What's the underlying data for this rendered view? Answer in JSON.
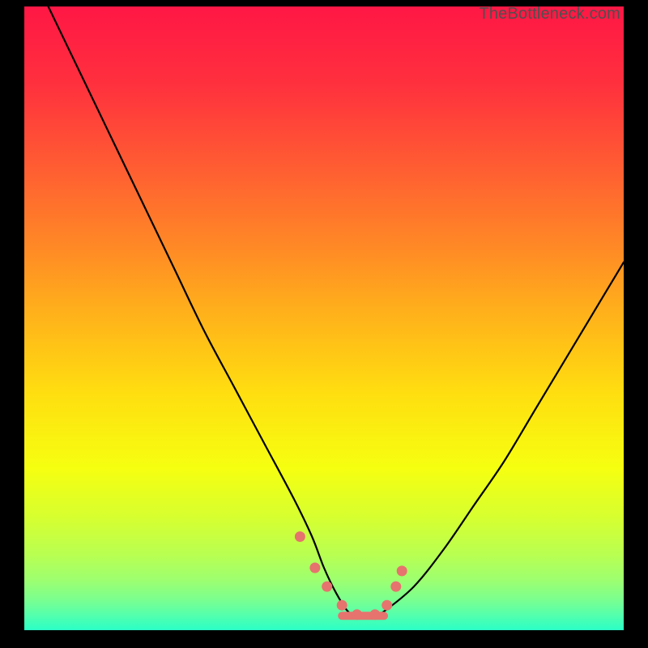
{
  "watermark": "TheBottleneck.com",
  "chart_data": {
    "type": "line",
    "title": "",
    "xlabel": "",
    "ylabel": "",
    "xlim": [
      0,
      100
    ],
    "ylim": [
      0,
      100
    ],
    "grid": false,
    "legend": false,
    "annotations": [],
    "series": [
      {
        "name": "main-curve",
        "x": [
          4,
          10,
          15,
          20,
          25,
          30,
          35,
          40,
          45,
          48,
          50,
          52,
          54,
          56,
          58,
          60,
          65,
          70,
          75,
          80,
          85,
          90,
          95,
          100
        ],
        "values": [
          100,
          88,
          78,
          68,
          58,
          48,
          39,
          30,
          21,
          15,
          10,
          6,
          3,
          2,
          2,
          3,
          7,
          13,
          20,
          27,
          35,
          43,
          51,
          59
        ]
      },
      {
        "name": "curve-markers",
        "x": [
          46.0,
          48.5,
          50.5,
          53.0,
          55.5,
          58.5,
          60.5,
          62.0,
          63.0
        ],
        "values": [
          15.0,
          10.0,
          7.0,
          4.0,
          2.5,
          2.5,
          4.0,
          7.0,
          9.5
        ]
      },
      {
        "name": "flat-line",
        "x": [
          53,
          60
        ],
        "values": [
          2.3,
          2.3
        ]
      }
    ],
    "gradient_stops": [
      {
        "offset": 0.0,
        "color": "#ff1745"
      },
      {
        "offset": 0.12,
        "color": "#ff2f3e"
      },
      {
        "offset": 0.25,
        "color": "#ff5a33"
      },
      {
        "offset": 0.38,
        "color": "#ff8726"
      },
      {
        "offset": 0.5,
        "color": "#ffb41a"
      },
      {
        "offset": 0.62,
        "color": "#ffde10"
      },
      {
        "offset": 0.74,
        "color": "#f6ff10"
      },
      {
        "offset": 0.82,
        "color": "#d6ff30"
      },
      {
        "offset": 0.88,
        "color": "#b8ff52"
      },
      {
        "offset": 0.92,
        "color": "#9dff70"
      },
      {
        "offset": 0.95,
        "color": "#7cff8e"
      },
      {
        "offset": 0.975,
        "color": "#55ffac"
      },
      {
        "offset": 1.0,
        "color": "#2bffc6"
      }
    ],
    "marker_color": "#e6736e",
    "curve_color": "#000000"
  }
}
